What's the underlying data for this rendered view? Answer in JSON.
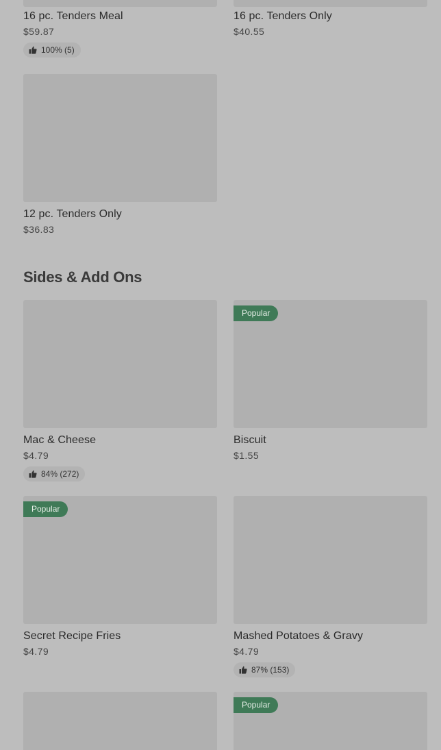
{
  "items": {
    "tenders16_meal": {
      "name": "16 pc. Tenders Meal",
      "price": "$59.87",
      "rating": "100% (5)"
    },
    "tenders16_only": {
      "name": "16 pc. Tenders Only",
      "price": "$40.55"
    },
    "tenders12_only": {
      "name": "12 pc. Tenders Only",
      "price": "$36.83"
    }
  },
  "sides": {
    "title": "Sides & Add Ons",
    "mac": {
      "name": "Mac & Cheese",
      "price": "$4.79",
      "rating": "84% (272)"
    },
    "biscuit": {
      "name": "Biscuit",
      "price": "$1.55",
      "badge": "Popular"
    },
    "fries": {
      "name": "Secret Recipe Fries",
      "price": "$4.79",
      "badge": "Popular"
    },
    "mashed": {
      "name": "Mashed Potatoes & Gravy",
      "price": "$4.79",
      "rating": "87% (153)"
    },
    "next_right": {
      "badge": "Popular"
    }
  },
  "icons": {
    "rating": "thumbs-up-icon"
  },
  "colors": {
    "popular_badge": "#3f7a57",
    "background": "#bdbdbd"
  }
}
